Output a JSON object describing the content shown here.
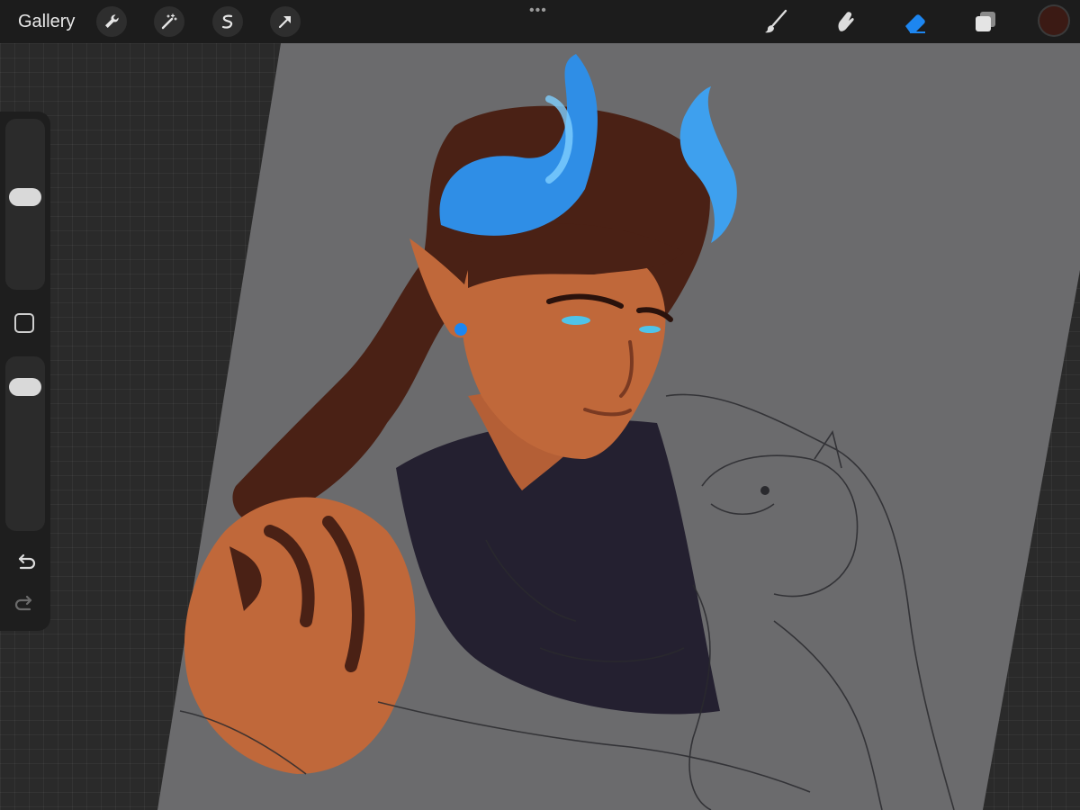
{
  "topbar": {
    "gallery_label": "Gallery",
    "left_tools": [
      "wrench-icon",
      "magic-wand-icon",
      "selection-icon",
      "transform-arrow-icon"
    ],
    "menu_dots": "•••",
    "right_tools": [
      "brush-icon",
      "smudge-icon",
      "eraser-icon",
      "layers-icon"
    ],
    "active_tool": "eraser-icon",
    "current_color": "#3b1a14"
  },
  "sidebar": {
    "brush_size_level": 0.45,
    "brush_opacity_level": 0.12,
    "controls": [
      "brush-size-slider",
      "modifier-square",
      "brush-opacity-slider",
      "undo-button",
      "redo-button"
    ]
  },
  "colors": {
    "paper": "#6b6b6d",
    "skin": "#c0683a",
    "hair": "#4a2115",
    "horn": "#2f8ee6",
    "shirt": "#242030",
    "accent_blue": "#1d86f0"
  }
}
